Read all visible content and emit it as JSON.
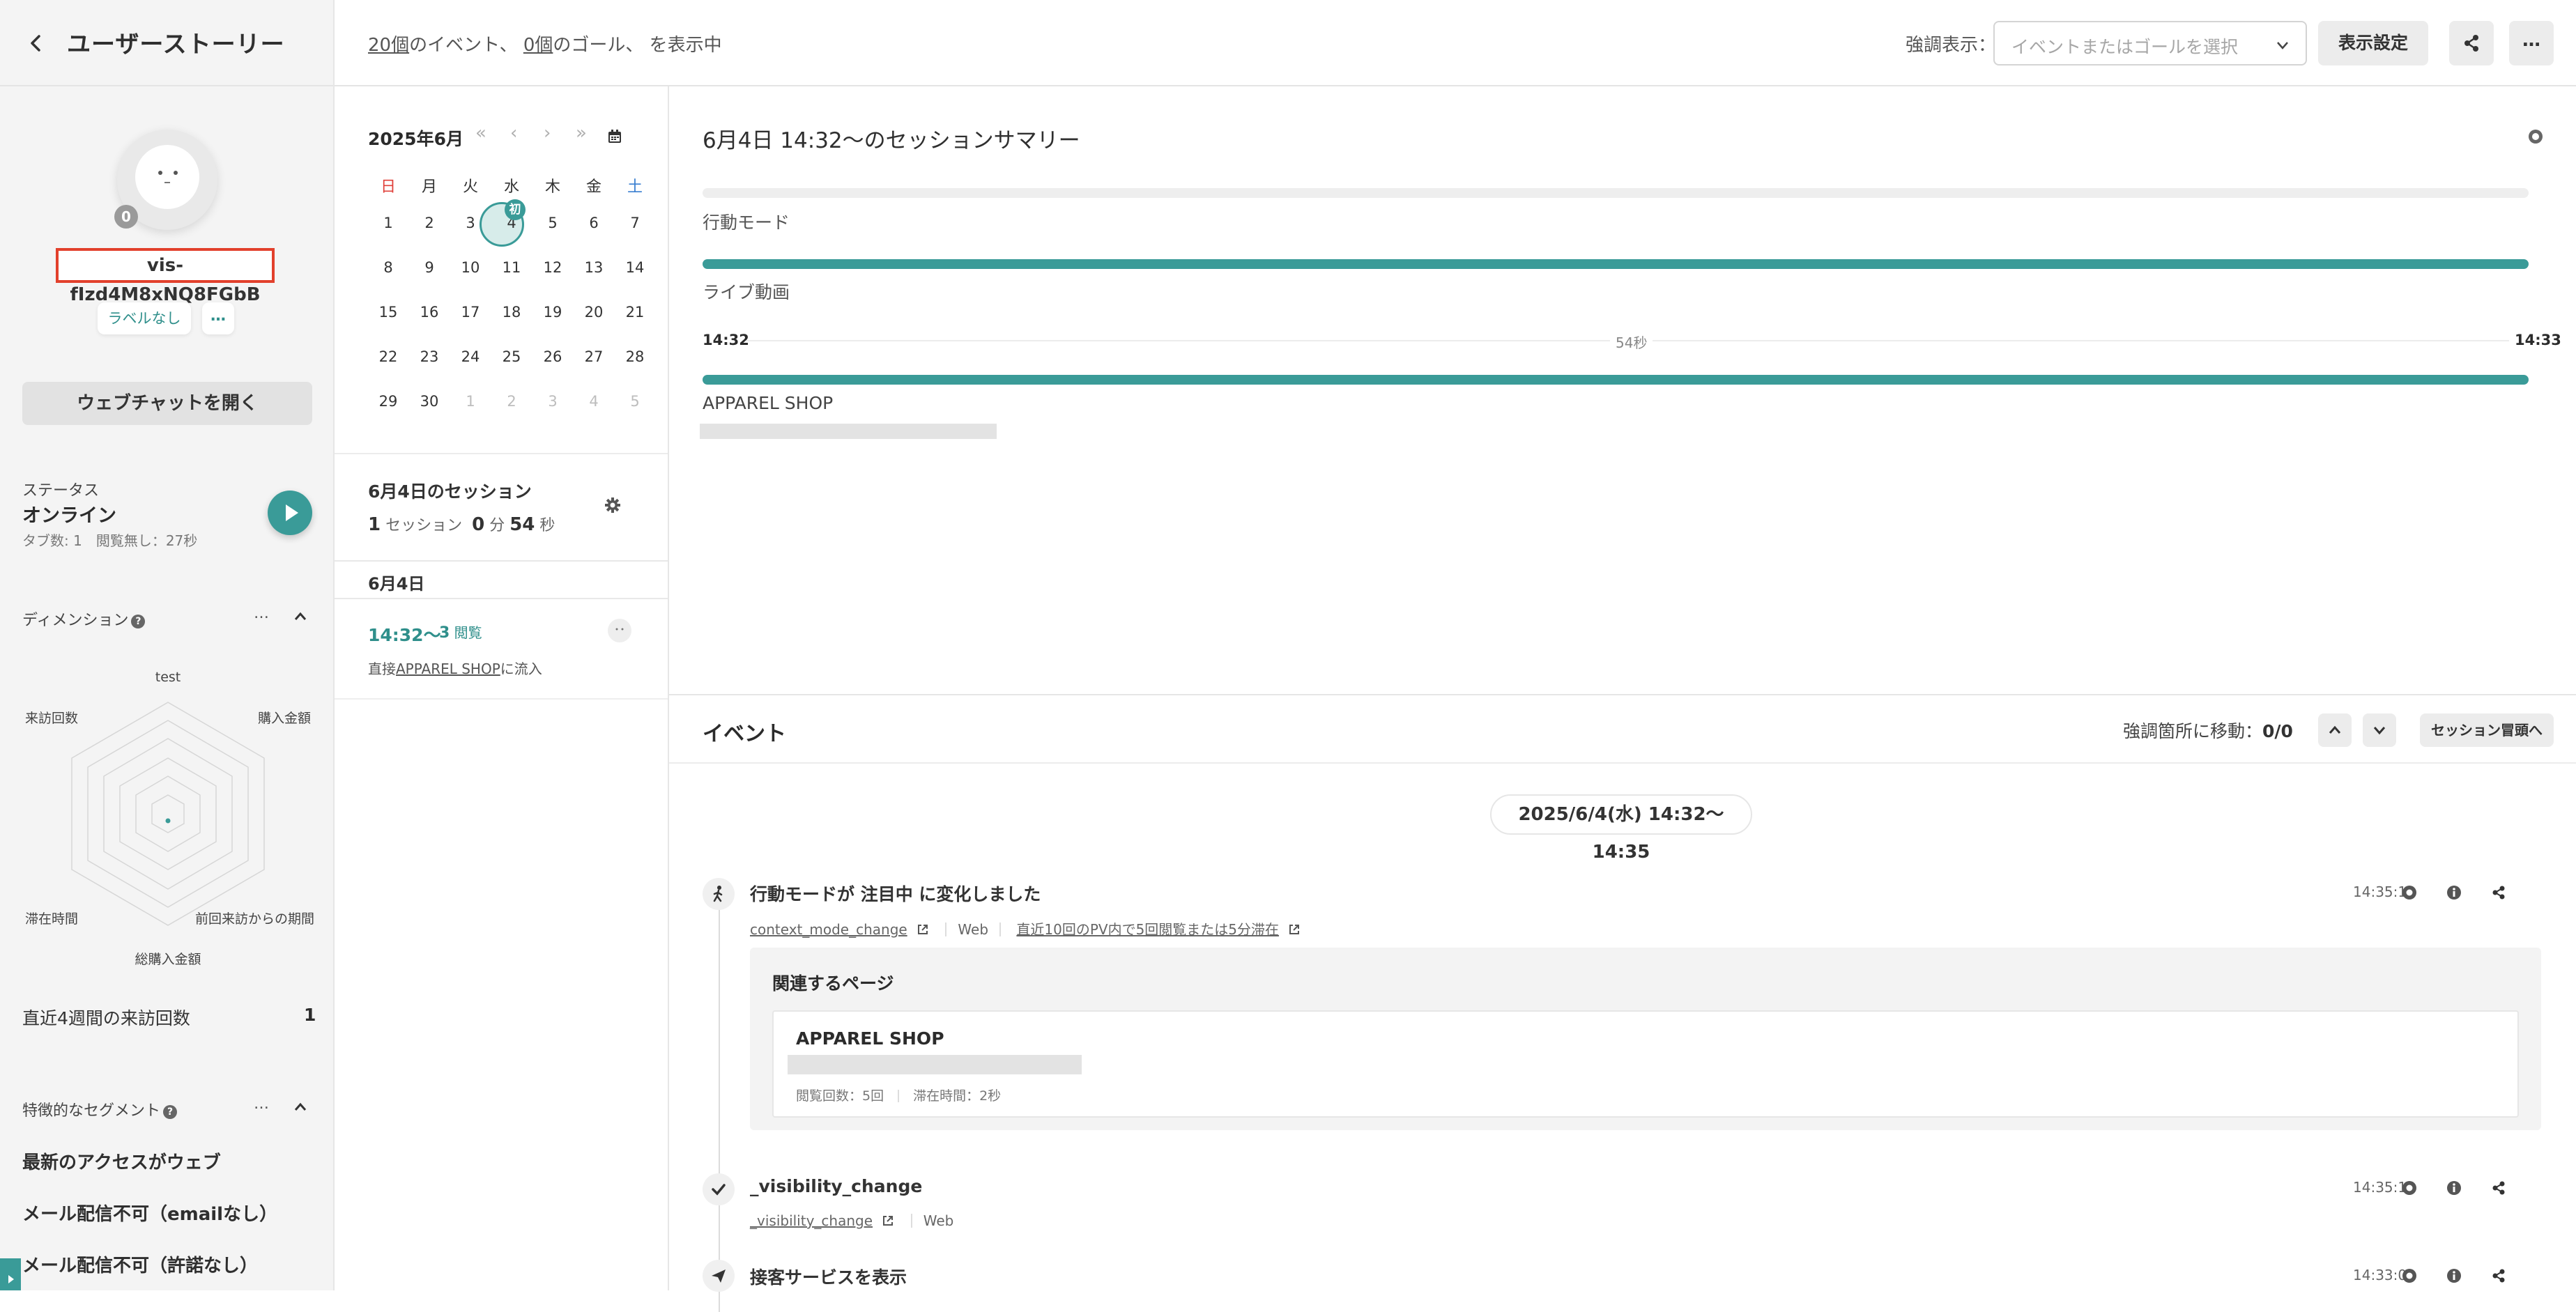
{
  "sidebar": {
    "title": "ユーザーストーリー",
    "avatar_badge": "0",
    "visitor_id": "vis-fIzd4M8xNQ8FGbB",
    "label_button": "ラベルなし",
    "label_more": "…",
    "webchat_button": "ウェブチャットを開く",
    "status_label": "ステータス",
    "status_value": "オンライン",
    "status_detail": "タブ数: 1　閲覧無し：27秒",
    "dimension_label": "ディメンション",
    "dimension_more": "…",
    "radar_labels": [
      "test",
      "購入金額",
      "前回来訪からの期間",
      "総購入金額",
      "滞在時間",
      "来訪回数"
    ],
    "visits_label": "直近4週間の来訪回数",
    "visits_value": "1",
    "segment_label": "特徴的なセグメント",
    "segment_more": "…",
    "segments": [
      "最新のアクセスがウェブ",
      "メール配信不可（emailなし）",
      "メール配信不可（許諾なし）"
    ]
  },
  "topbar": {
    "events_count": "20個",
    "events_text": "のイベント、",
    "goals_count": "0個",
    "goals_text": "のゴール、 を表示中",
    "highlight_label": "強調表示：",
    "highlight_placeholder": "イベントまたはゴールを選択",
    "display_settings": "表示設定",
    "more": "…"
  },
  "calendar": {
    "month": "2025年6月",
    "nav": [
      "«",
      "‹",
      "›",
      "»"
    ],
    "weekdays": [
      "日",
      "月",
      "火",
      "水",
      "木",
      "金",
      "土"
    ],
    "weeks": [
      [
        "1",
        "2",
        "3",
        "4",
        "5",
        "6",
        "7"
      ],
      [
        "8",
        "9",
        "10",
        "11",
        "12",
        "13",
        "14"
      ],
      [
        "15",
        "16",
        "17",
        "18",
        "19",
        "20",
        "21"
      ],
      [
        "22",
        "23",
        "24",
        "25",
        "26",
        "27",
        "28"
      ],
      [
        "29",
        "30",
        "1",
        "2",
        "3",
        "4",
        "5"
      ]
    ],
    "first_badge": "初",
    "colors": {
      "sunday": "#e0403a",
      "saturday": "#3a7fd0",
      "accent": "#3a9b98"
    }
  },
  "sessions": {
    "title": "6月4日のセッション",
    "count": "1",
    "count_unit": "セッション",
    "minutes": "0",
    "minutes_unit": "分",
    "seconds": "54",
    "seconds_unit": "秒",
    "date_header": "6月4日",
    "item": {
      "time": "14:32〜",
      "pv_count": "3",
      "pv_unit": "閲覧",
      "desc_prefix": "直接",
      "desc_link": "APPAREL SHOP",
      "desc_suffix": "に流入"
    }
  },
  "summary": {
    "title": "6月4日 14:32〜のセッションサマリー",
    "behavior_mode": "行動モード",
    "live_video": "ライブ動画",
    "time_start": "14:32",
    "duration": "54秒",
    "time_end": "14:33",
    "page_title": "APPAREL SHOP"
  },
  "events": {
    "title": "イベント",
    "jump_label": "強調箇所に移動：",
    "jump_value": "0/0",
    "session_top": "セッション冒頭へ",
    "date_range": "2025/6/4(水) 14:32〜14:35",
    "items": [
      {
        "title": "行動モードが 注目中 に変化しました",
        "time": "14:35:13",
        "link": "context_mode_change",
        "channel": "Web",
        "condition": "直近10回のPV内で5回閲覧または5分滞在"
      },
      {
        "title": "_visibility_change",
        "time": "14:35:13",
        "link": "_visibility_change",
        "channel": "Web"
      },
      {
        "title": "接客サービスを表示",
        "time": "14:33:03"
      }
    ],
    "related": {
      "title": "関連するページ",
      "page_title": "APPAREL SHOP",
      "views": "閲覧回数：5回",
      "stay": "滞在時間：2秒"
    }
  }
}
